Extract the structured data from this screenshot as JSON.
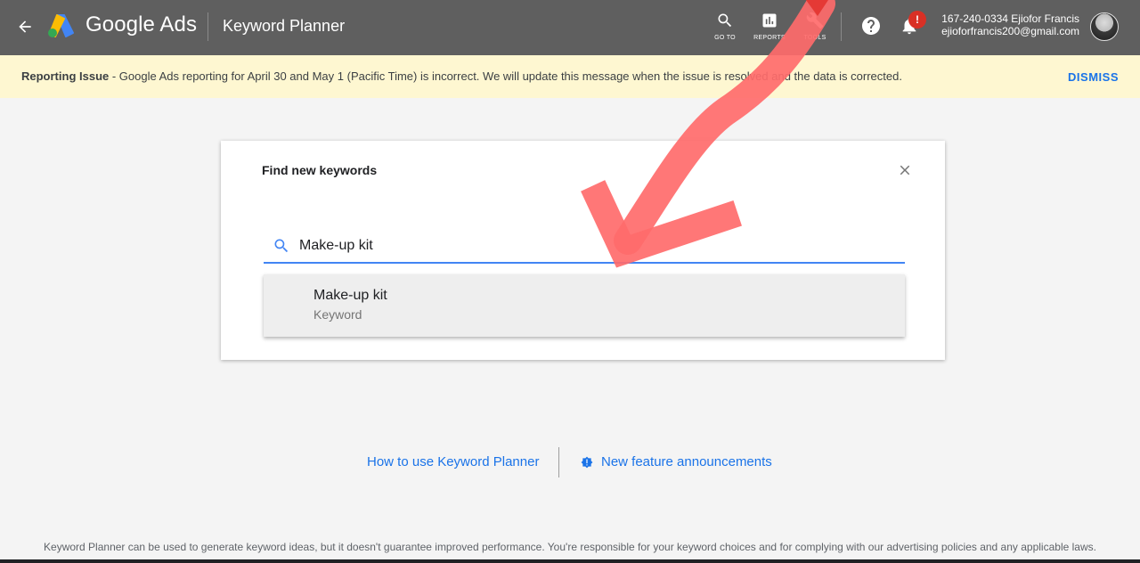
{
  "header": {
    "back_icon": "arrow-back-icon",
    "brand": "Google Ads",
    "app_title": "Keyword Planner",
    "tools": [
      {
        "label": "GO TO",
        "icon": "search-icon"
      },
      {
        "label": "REPORTS",
        "icon": "bar-chart-icon"
      },
      {
        "label": "TOOLS",
        "icon": "wrench-icon"
      }
    ],
    "notification_badge": "!",
    "account_line1": "167-240-0334 Ejiofor Francis",
    "account_line2": "ejioforfrancis200@gmail.com"
  },
  "banner": {
    "title": "Reporting Issue",
    "message": " - Google Ads reporting for April 30 and May 1 (Pacific Time) is incorrect. We will update this message when the issue is resolved and the data is corrected.",
    "dismiss_label": "DISMISS"
  },
  "dialog": {
    "title": "Find new keywords",
    "search_value": "Make-up kit",
    "suggestion": {
      "text": "Make-up kit",
      "type": "Keyword"
    }
  },
  "links": {
    "how_to": "How to use Keyword Planner",
    "announcements": "New feature announcements"
  },
  "footer": {
    "disclaimer": "Keyword Planner can be used to generate keyword ideas, but it doesn't guarantee improved performance. You're responsible for your keyword choices and for complying with our advertising policies and any applicable laws."
  },
  "colors": {
    "topbar": "#5f5f5f",
    "banner": "#fef7d1",
    "accent": "#1a73e8",
    "annotation": "#ff6b6b"
  }
}
